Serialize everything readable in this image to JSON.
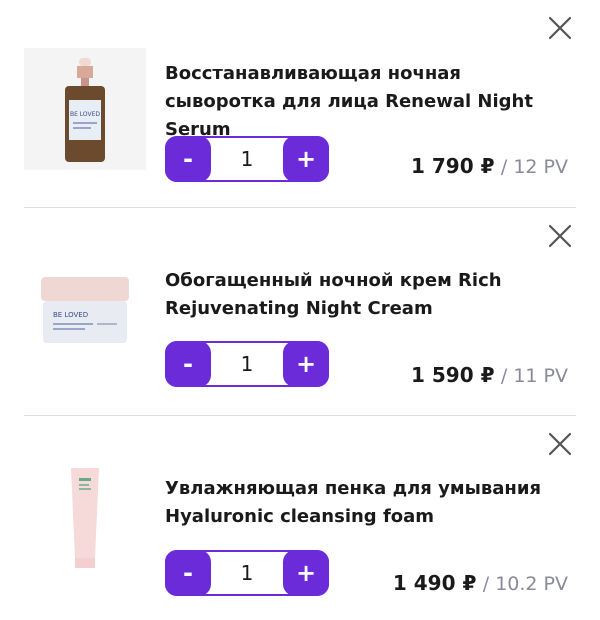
{
  "cart": {
    "accent_color": "#6b2bd9",
    "items": [
      {
        "title": "Восстанавливающая ночная сыворотка для лица Renewal Night Serum",
        "quantity": "1",
        "price": "1 790 ₽",
        "pv": "/ 12 PV",
        "image": "serum-bottle-image",
        "minus_label": "-",
        "plus_label": "+"
      },
      {
        "title": "Обогащенный ночной крем Rich Rejuvenating Night Cream",
        "quantity": "1",
        "price": "1 590 ₽",
        "pv": "/ 11 PV",
        "image": "cream-jar-image",
        "minus_label": "-",
        "plus_label": "+"
      },
      {
        "title": "Увлажняющая пенка для умывания Hyaluronic cleansing foam",
        "quantity": "1",
        "price": "1 490 ₽",
        "pv": "/ 10.2 PV",
        "image": "foam-tube-image",
        "minus_label": "-",
        "plus_label": "+"
      }
    ]
  }
}
